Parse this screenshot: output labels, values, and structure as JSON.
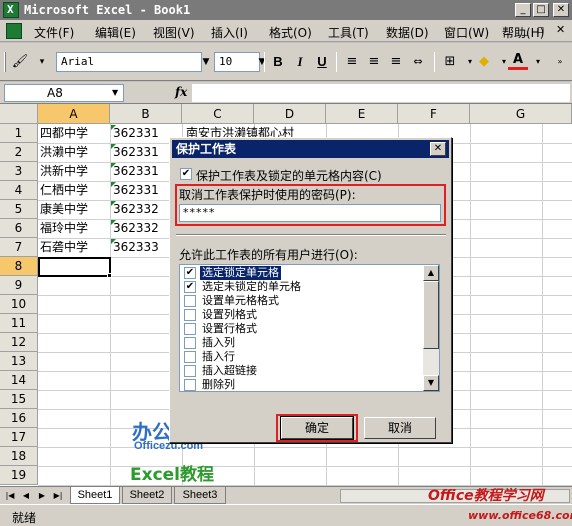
{
  "window": {
    "title": "Microsoft Excel - Book1"
  },
  "menu": [
    "文件(F)",
    "编辑(E)",
    "视图(V)",
    "插入(I)",
    "格式(O)",
    "工具(T)",
    "数据(D)",
    "窗口(W)",
    "帮助(H)"
  ],
  "toolbar": {
    "font": "Arial",
    "size": "10",
    "bold": "B",
    "italic": "I",
    "underline": "U"
  },
  "formula": {
    "name_box": "A8",
    "fx": "fx"
  },
  "columns": [
    "A",
    "B",
    "C",
    "D",
    "E",
    "F",
    "G"
  ],
  "rows": [
    "1",
    "2",
    "3",
    "4",
    "5",
    "6",
    "7",
    "8",
    "9",
    "10",
    "11",
    "12",
    "13",
    "14",
    "15",
    "16",
    "17",
    "18",
    "19"
  ],
  "cells": {
    "a": [
      "四都中学",
      "洪濑中学",
      "洪新中学",
      "仁栖中学",
      "康美中学",
      "福玲中学",
      "石砻中学"
    ],
    "b": [
      "362331",
      "362331",
      "362331",
      "362331",
      "362332",
      "362332",
      "362333"
    ],
    "c1": "南安市洪濑镇都心村"
  },
  "sheets": [
    "Sheet1",
    "Sheet2",
    "Sheet3"
  ],
  "status": "就绪",
  "dialog": {
    "title": "保护工作表",
    "protect_label": "保护工作表及锁定的单元格内容(C)",
    "password_label": "取消工作表保护时使用的密码(P):",
    "password_value": "*****",
    "allow_label": "允许此工作表的所有用户进行(O):",
    "permissions": [
      {
        "label": "选定锁定单元格",
        "checked": true
      },
      {
        "label": "选定未锁定的单元格",
        "checked": true
      },
      {
        "label": "设置单元格格式",
        "checked": false
      },
      {
        "label": "设置列格式",
        "checked": false
      },
      {
        "label": "设置行格式",
        "checked": false
      },
      {
        "label": "插入列",
        "checked": false
      },
      {
        "label": "插入行",
        "checked": false
      },
      {
        "label": "插入超链接",
        "checked": false
      },
      {
        "label": "删除列",
        "checked": false
      }
    ],
    "ok": "确定",
    "cancel": "取消"
  },
  "watermarks": {
    "logo_cn": "办公族",
    "logo_en": "Officezu.com",
    "excel": "Excel教程",
    "site_cn": "Office教程学习网",
    "site_url": "www.office68.com"
  },
  "colors": {
    "title_active": "#0a246a",
    "highlight_header": "#f7c86b",
    "red_frame": "#e02020"
  }
}
